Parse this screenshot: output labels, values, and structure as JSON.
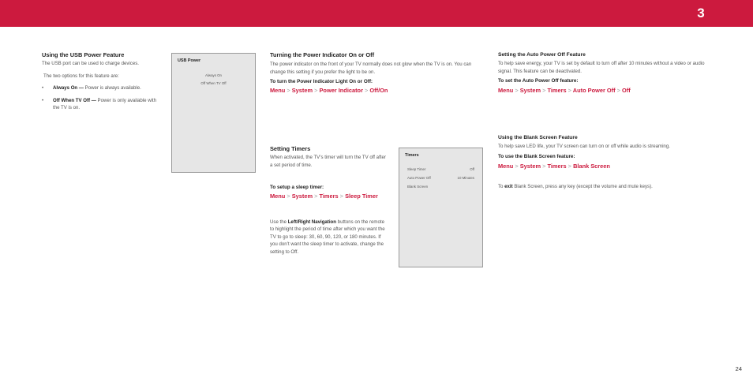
{
  "header": {
    "chapter": "3"
  },
  "usb": {
    "title": "Using the USB Power Feature",
    "intro": "The USB port can be used to charge devices.",
    "options_intro": "The two options for this feature are:",
    "bullets": [
      {
        "marker": "•",
        "term": "Always On —",
        "text": " Power is always available."
      },
      {
        "marker": "•",
        "term": "Off When TV Off —",
        "text": " Power is only available with the TV is on."
      }
    ],
    "screen": {
      "title": "USB Power",
      "items": [
        "Always On",
        "Off When TV Off"
      ]
    }
  },
  "power_indicator": {
    "title": "Turning the Power Indicator On or Off",
    "body": "The power indicator on the front of your TV normally does not glow when the TV is on. You can change this setting if you prefer the light to be on.",
    "subhead": "To turn the Power Indicator Light On or Off:",
    "path": [
      "Menu",
      "System",
      "Power Indicator",
      "Off/On"
    ],
    "separator": ">"
  },
  "timers": {
    "title": "Setting Timers",
    "body": "When activated, the TV’s timer will turn the TV off after a set period of time.",
    "subhead": "To setup a sleep timer:",
    "path": [
      "Menu",
      "System",
      "Timers",
      "Sleep Timer"
    ],
    "nav_before": "Use the ",
    "nav_bold": "Left/Right Navigation",
    "nav_after": " buttons on the remote to highlight the period of time after which you want the TV to go to sleep: 30, 60, 90, 120, or 180 minutes. If you don’t want the sleep timer to activate, change the setting to Off.",
    "screen": {
      "title": "Timers",
      "rows": [
        {
          "label": "Sleep Timer",
          "value": "Off"
        },
        {
          "label": "Auto Power Off",
          "value": "10 Minutes"
        },
        {
          "label": "Blank Screen",
          "value": ""
        }
      ]
    }
  },
  "auto_power_off": {
    "title": "Setting the Auto Power Off Feature",
    "body": "To help save energy, your TV is set by default to turn off after 10 minutes without a video or audio signal. This feature can be deactivated.",
    "subhead": "To set the Auto Power Off feature:",
    "path": [
      "Menu",
      "System",
      "Timers",
      "Auto Power Off",
      "Off"
    ]
  },
  "blank_screen": {
    "title": "Using the Blank Screen Feature",
    "body": "To help save LED life, your TV screen can turn on or off while audio is streaming.",
    "subhead": "To use the Blank Screen feature:",
    "path": [
      "Menu",
      "System",
      "Timers",
      "Blank Screen"
    ],
    "exit_before": "To ",
    "exit_bold": "exit",
    "exit_after": " Blank Screen, press any key (except the volume and mute keys)."
  },
  "footer": {
    "page_number": "24"
  },
  "colors": {
    "accent": "#cc1a3e",
    "screen_bg": "#e6e6e6"
  }
}
